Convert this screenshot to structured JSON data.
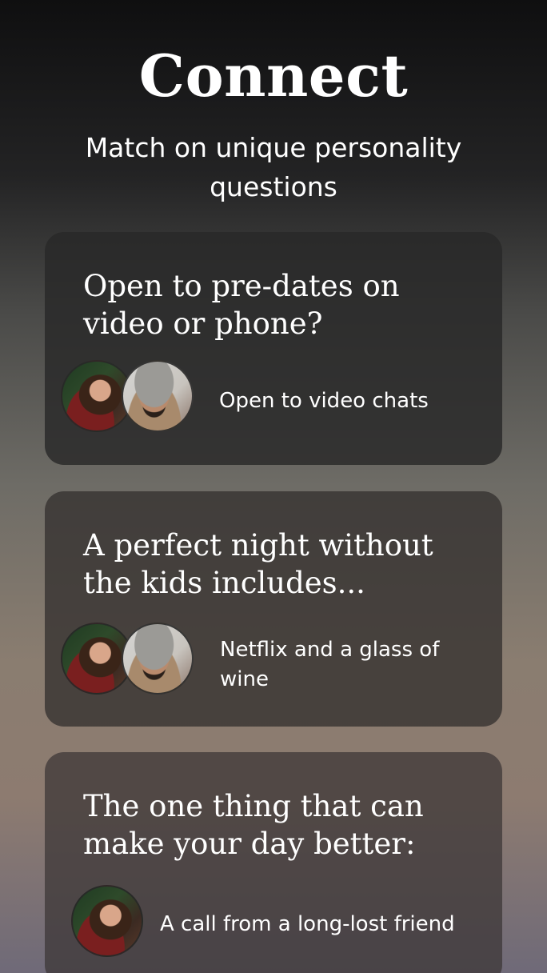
{
  "header": {
    "title": "Connect",
    "subtitle": "Match on unique personality questions"
  },
  "cards": [
    {
      "question": "Open to pre-dates on video or phone?",
      "answer": "Open to video chats",
      "avatars": [
        "woman-avatar",
        "man-avatar"
      ]
    },
    {
      "question": "A perfect night without the kids includes...",
      "answer": "Netflix and a glass of wine",
      "avatars": [
        "woman-avatar",
        "man-avatar"
      ]
    },
    {
      "question": "The one thing that can make your day better:",
      "answer": "A call from a long-lost friend",
      "avatars": [
        "woman-avatar"
      ]
    }
  ]
}
